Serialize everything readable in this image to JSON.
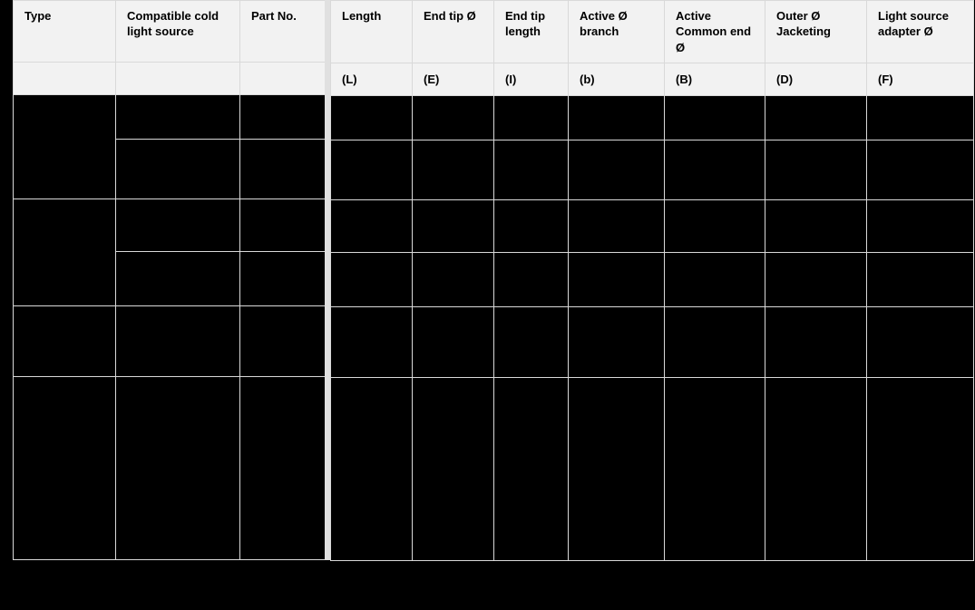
{
  "table": {
    "name": "fiber-optic-light-guide-specification-table",
    "header_rows": [
      {
        "cells": [
          "Type",
          "Compatible cold light source",
          "Part No.",
          "Length",
          "End tip Ø",
          "End tip length",
          "Active Ø branch",
          "Active Common end  Ø",
          "Outer Ø Jacketing",
          "Light source adapter Ø"
        ]
      },
      {
        "cells": [
          "",
          "",
          "",
          "(L)",
          "(E)",
          "(I)",
          "(b)",
          "(B)",
          "(D)",
          "(F)"
        ]
      }
    ],
    "symbols": {
      "length": "(L)",
      "end_tip_diameter": "(E)",
      "end_tip_length": "(I)",
      "active_diameter_branch": "(b)",
      "active_common_end_diameter": "(B)",
      "outer_diameter_jacketing": "(D)",
      "light_source_adapter_diameter": "(F)"
    },
    "body_rows": [
      {
        "id": "row-1",
        "type": "",
        "type_rowspan": 2,
        "cold_light_source": "",
        "part_no": "",
        "length": "",
        "end_tip_diameter": "",
        "end_tip_length": "",
        "active_diameter_branch": "",
        "active_common_end_diameter": "",
        "outer_diameter_jacketing": "",
        "light_source_adapter_diameter": ""
      },
      {
        "id": "row-2",
        "type": null,
        "cold_light_source": "",
        "part_no": "",
        "length": "",
        "end_tip_diameter": "",
        "end_tip_length": "",
        "active_diameter_branch": "",
        "active_common_end_diameter": "",
        "outer_diameter_jacketing": "",
        "light_source_adapter_diameter": ""
      },
      {
        "id": "row-3",
        "type": "",
        "type_rowspan": 2,
        "cold_light_source": "",
        "part_no": "",
        "length": "",
        "end_tip_diameter": "",
        "end_tip_length": "",
        "active_diameter_branch": "",
        "active_common_end_diameter": "",
        "outer_diameter_jacketing": "",
        "light_source_adapter_diameter": ""
      },
      {
        "id": "row-4",
        "type": null,
        "cold_light_source": "",
        "part_no": "",
        "length": "",
        "end_tip_diameter": "",
        "end_tip_length": "",
        "active_diameter_branch": "",
        "active_common_end_diameter": "",
        "outer_diameter_jacketing": "",
        "light_source_adapter_diameter": ""
      },
      {
        "id": "row-5",
        "type": "",
        "type_rowspan": 1,
        "cold_light_source": "",
        "part_no": "",
        "length": "",
        "end_tip_diameter": "",
        "end_tip_length": "",
        "active_diameter_branch": "",
        "active_common_end_diameter": "",
        "outer_diameter_jacketing": "",
        "light_source_adapter_diameter": ""
      },
      {
        "id": "row-6",
        "type": "",
        "type_rowspan": 1,
        "cold_light_source": "",
        "part_no": "",
        "length": "",
        "end_tip_diameter": "",
        "end_tip_length": "",
        "active_diameter_branch": "",
        "active_common_end_diameter": "",
        "outer_diameter_jacketing": "",
        "light_source_adapter_diameter": ""
      }
    ]
  },
  "colors": {
    "page_background": "#000000",
    "header_background": "#f2f2f2",
    "grid_line": "#d9d9d9",
    "gutter": "#e0e0e0",
    "text": "#000000",
    "redacted_cell": "#000000"
  }
}
